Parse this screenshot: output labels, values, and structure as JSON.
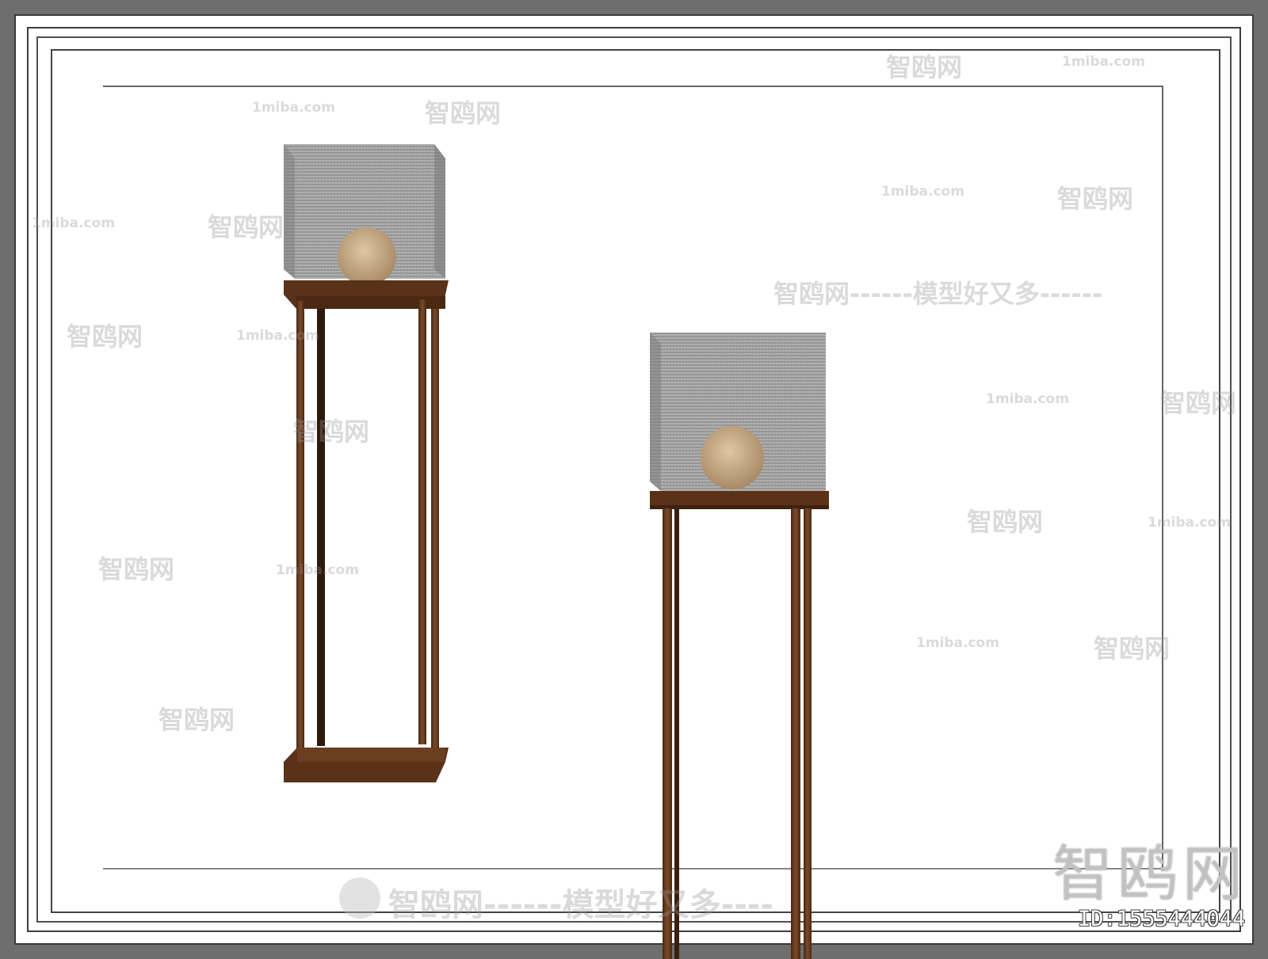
{
  "watermark": {
    "site": "1miba.com",
    "brand": "智鸥网",
    "dashes": "------",
    "slogan": "智鸥网------模型好又多------",
    "bottom_slogan": "智鸥网------模型好又多----",
    "corner_logo": "智鸥网",
    "asset_id": "ID:1555444044"
  },
  "scene": {
    "subject": "two floor lamps with mesh cube shades",
    "colors": {
      "background": "#ffffff",
      "border": "#6e6e6e",
      "wood": "#5a3218",
      "rust": "#7a4a2a",
      "mesh": "#8a8a8a",
      "bulb": "#c8a882"
    }
  }
}
